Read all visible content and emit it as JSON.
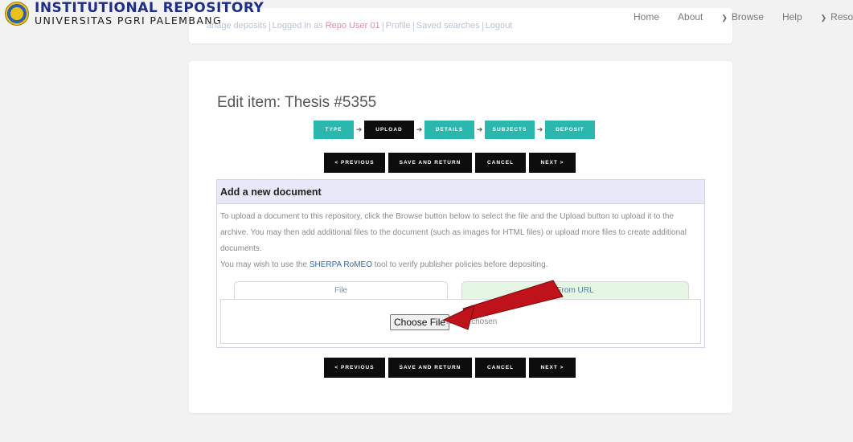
{
  "header": {
    "logo_title": "INSTITUTIONAL REPOSITORY",
    "logo_subtitle": "UNIVERSITAS PGRI PALEMBANG",
    "user_links": {
      "manage_deposits": "anage deposits",
      "logged_in_prefix": "Logged in as",
      "user": "Repo User 01",
      "profile": "Profile",
      "saved_searches": "Saved searches",
      "logout": "Logout"
    },
    "nav": [
      "Home",
      "About",
      "Browse",
      "Help",
      "Resou"
    ]
  },
  "page": {
    "title": "Edit item: Thesis #5355",
    "stages": [
      {
        "label": "TYPE",
        "active": false
      },
      {
        "label": "UPLOAD",
        "active": true
      },
      {
        "label": "DETAILS",
        "active": false
      },
      {
        "label": "SUBJECTS",
        "active": false
      },
      {
        "label": "DEPOSIT",
        "active": false
      }
    ],
    "buttons": {
      "previous": "< PREVIOUS",
      "save_return": "SAVE AND RETURN",
      "cancel": "CANCEL",
      "next": "NEXT >"
    }
  },
  "document": {
    "heading": "Add a new document",
    "instructions": "To upload a document to this repository, click the Browse button below to select the file and the Upload button to upload it to the archive. You may then add additional files to the document (such as images for HTML files) or upload more files to create additional documents.",
    "sherpa_prefix": "You may wish to use the",
    "sherpa_link": "SHERPA RoMEO",
    "sherpa_suffix": "tool to verify publisher policies before depositing.",
    "tab_file": "File",
    "tab_url": "From URL",
    "choose_file": "Choose File",
    "no_file": "No file chosen"
  },
  "colors": {
    "accent_teal": "#2ab8ae",
    "dark": "#0d0d0d",
    "annotation_arrow": "#c0121a"
  }
}
